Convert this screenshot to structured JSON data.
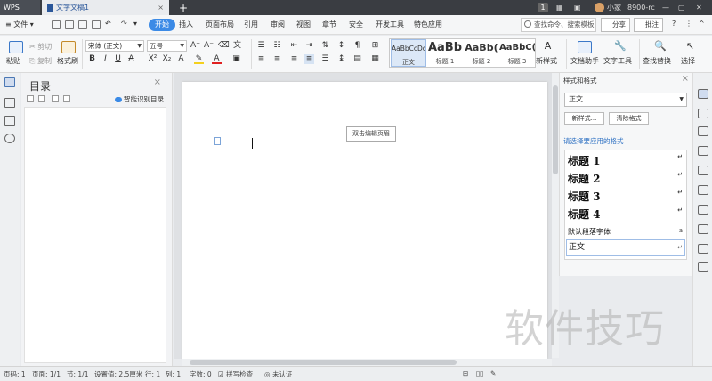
{
  "titlebar": {
    "app_tab": "WPS",
    "doc_tab": "文字文稿1",
    "add_tab": "+",
    "user": "小家",
    "build": "8900-rc",
    "page_badge": "1"
  },
  "menu": {
    "file": "文件",
    "items": [
      "开始",
      "插入",
      "页面布局",
      "引用",
      "审阅",
      "视图",
      "章节",
      "安全",
      "开发工具",
      "特色应用"
    ],
    "active_index": 0,
    "search_placeholder": "查找命令、搜索模板",
    "share": "分享",
    "comment": "批注",
    "help": "?",
    "more": "⋮",
    "collapse": "^"
  },
  "ribbon": {
    "paste": "粘贴",
    "cut": "剪切",
    "copy": "复制",
    "format_painter": "格式刷",
    "font_name": "宋体 (正文)",
    "font_size": "五号",
    "styles": [
      {
        "preview": "AaBbCcDd",
        "label": "正文"
      },
      {
        "preview": "AaBb",
        "label": "标题 1"
      },
      {
        "preview": "AaBb(",
        "label": "标题 2"
      },
      {
        "preview": "AaBbC(",
        "label": "标题 3"
      }
    ],
    "new_style": "新样式",
    "doc_assistant": "文档助手",
    "text_tools": "文字工具",
    "find_replace": "查找替换",
    "select": "选择"
  },
  "toc": {
    "title": "目录",
    "smart_toc": "智能识别目录",
    "close": "×"
  },
  "document": {
    "header_tip": "双击编辑页眉"
  },
  "style_panel": {
    "title": "样式和格式",
    "current_style": "正文",
    "new_style_btn": "新样式...",
    "clear_btn": "清除格式",
    "prompt": "请选择要应用的格式",
    "styles": [
      {
        "name": "标题 1",
        "mark": "↵"
      },
      {
        "name": "标题 2",
        "mark": "↵"
      },
      {
        "name": "标题 3",
        "mark": "↵"
      },
      {
        "name": "标题 4",
        "mark": "↵"
      },
      {
        "name": "默认段落字体",
        "mark": "a"
      },
      {
        "name": "正文",
        "mark": "↵"
      }
    ],
    "close": "×"
  },
  "statusbar": {
    "page_num": "页码: 1",
    "page_total": "页面: 1/1",
    "section": "节: 1/1",
    "setting": "设置值: 2.5厘米",
    "row": "行: 1",
    "col": "列: 1",
    "words": "字数: 0",
    "spell": "拼写检查",
    "cert": "未认证"
  },
  "watermark": "软件技巧",
  "colors": {
    "accent": "#3b8ae6",
    "titlebar": "#3a3d42",
    "link": "#2b6fc2"
  }
}
